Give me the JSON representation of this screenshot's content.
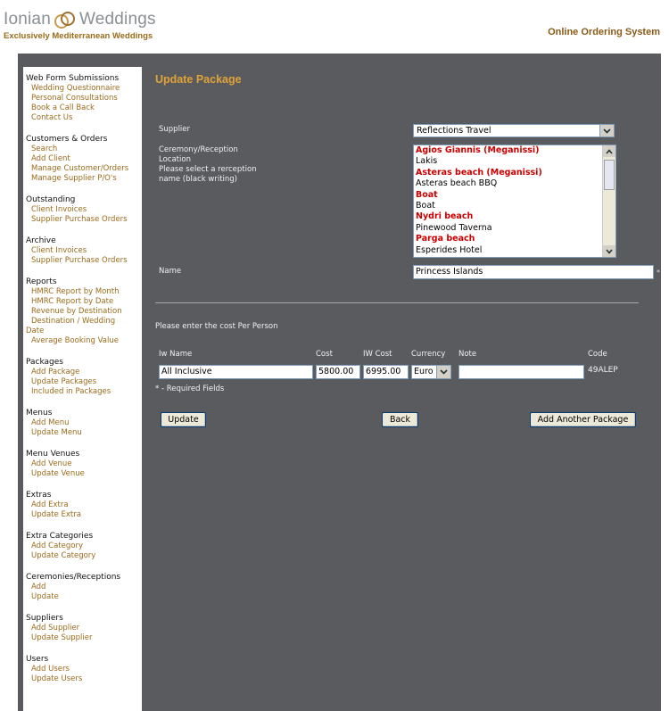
{
  "header": {
    "logo_left": "Ionian",
    "logo_right": "Weddings",
    "tagline": "Exclusively Mediterranean Weddings",
    "system_title": "Online Ordering System"
  },
  "sidebar": {
    "groups": [
      {
        "head": "Web Form Submissions",
        "links": [
          "Wedding Questionnaire",
          "Personal Consultations",
          "Book a Call Back",
          "Contact Us"
        ]
      },
      {
        "head": "Customers & Orders",
        "links": [
          "Search",
          "Add Client",
          "Manage Customer/Orders",
          "Manage Supplier P/O's"
        ]
      },
      {
        "head": "Outstanding",
        "links": [
          "Client Invoices",
          "Supplier Purchase Orders"
        ]
      },
      {
        "head": "Archive",
        "links": [
          "Client Invoices",
          "Supplier Purchase Orders"
        ]
      },
      {
        "head": "Reports",
        "links": [
          "HMRC Report by Month",
          "HMRC Report by Date",
          "Revenue by Destination",
          "Destination / Wedding",
          "Date",
          "Average Booking Value"
        ]
      },
      {
        "head": "Packages",
        "links": [
          "Add Package",
          "Update Packages",
          "Included in Packages"
        ]
      },
      {
        "head": "Menus",
        "links": [
          "Add Menu",
          "Update Menu"
        ]
      },
      {
        "head": "Menu Venues",
        "links": [
          "Add Venue",
          "Update Venue"
        ]
      },
      {
        "head": "Extras",
        "links": [
          "Add Extra",
          "Update Extra"
        ]
      },
      {
        "head": "Extra Categories",
        "links": [
          "Add Category",
          "Update Category"
        ]
      },
      {
        "head": "Ceremonies/Receptions",
        "links": [
          "Add",
          "Update"
        ]
      },
      {
        "head": "Suppliers",
        "links": [
          "Add Supplier",
          "Update Supplier"
        ]
      },
      {
        "head": "Users",
        "links": [
          "Add Users",
          "Update Users"
        ]
      }
    ]
  },
  "form": {
    "title": "Update Package",
    "supplier_label": "Supplier",
    "supplier_value": "Reflections Travel",
    "ceremony_label1": "Ceremony/Reception",
    "ceremony_label2": "Location",
    "ceremony_help": "Please select a rerception name (black writing)",
    "ceremony_options": [
      {
        "text": "Agios Giannis (Meganissi)",
        "style": "red"
      },
      {
        "text": "Lakis",
        "style": "black"
      },
      {
        "text": "Asteras beach (Meganissi)",
        "style": "red"
      },
      {
        "text": "Asteras beach BBQ",
        "style": "black"
      },
      {
        "text": "Boat",
        "style": "red"
      },
      {
        "text": "Boat",
        "style": "black"
      },
      {
        "text": "Nydri beach",
        "style": "red"
      },
      {
        "text": "Pinewood Taverna",
        "style": "black"
      },
      {
        "text": "Parga beach",
        "style": "red"
      },
      {
        "text": "Esperides Hotel",
        "style": "black"
      }
    ],
    "name_label": "Name",
    "name_value": "Princess Islands",
    "required_mark": "*",
    "cost_intro": "Please enter the cost Per Person",
    "col_iw_name": "Iw Name",
    "col_cost": "Cost",
    "col_iw_cost": "IW Cost",
    "col_currency": "Currency",
    "col_note": "Note",
    "col_code": "Code",
    "iw_name_value": "All Inclusive",
    "cost_value": "5800.00",
    "iw_cost_value": "6995.00",
    "currency_value": "Euro",
    "note_value": "",
    "code_value": "49ALEP",
    "required_note": "* - Required Fields",
    "update_label": "Update",
    "back_label": "Back",
    "add_another_label": "Add Another Package"
  }
}
